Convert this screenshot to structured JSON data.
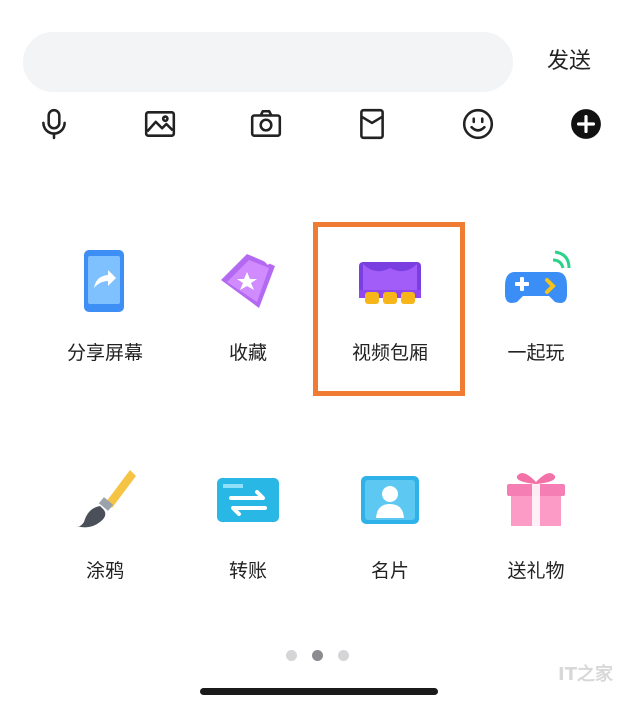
{
  "composer": {
    "placeholder": "",
    "send_label": "发送"
  },
  "toolbar": {
    "icons": [
      "microphone-icon",
      "image-icon",
      "camera-icon",
      "red-packet-icon",
      "emoji-icon",
      "plus-icon"
    ]
  },
  "panel": {
    "row1": [
      {
        "label": "分享屏幕",
        "icon": "share-screen-icon"
      },
      {
        "label": "收藏",
        "icon": "favorite-icon"
      },
      {
        "label": "视频包厢",
        "icon": "video-room-icon"
      },
      {
        "label": "一起玩",
        "icon": "game-controller-icon"
      }
    ],
    "row2": [
      {
        "label": "涂鸦",
        "icon": "brush-icon"
      },
      {
        "label": "转账",
        "icon": "transfer-icon"
      },
      {
        "label": "名片",
        "icon": "contact-card-icon"
      },
      {
        "label": "送礼物",
        "icon": "gift-icon"
      }
    ],
    "page_indicator": {
      "pages": 3,
      "current": 2
    }
  },
  "highlight_color": "#f07c34",
  "watermark": "IT之家"
}
